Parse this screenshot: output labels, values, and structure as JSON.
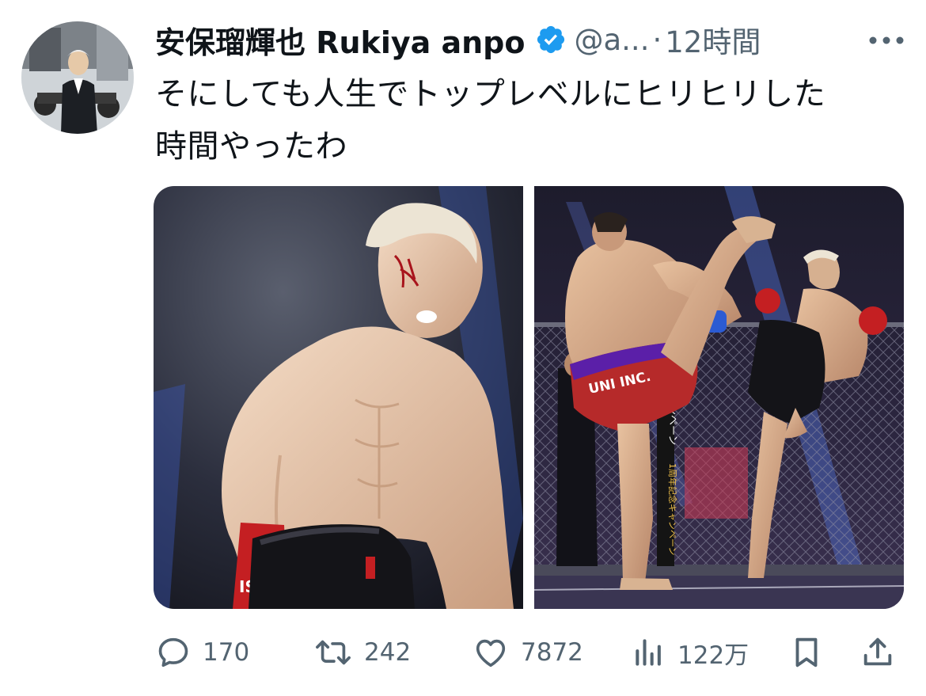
{
  "tweet": {
    "author": {
      "display_name": "安保瑠輝也 Rukiya anpo",
      "handle": "@a...",
      "verified_icon": "verified-badge-icon"
    },
    "separator": "·",
    "timestamp": "12時間",
    "text_line1": "そにしても人生でトップレベルにヒリヒリした",
    "text_line2": "時間やったわ"
  },
  "media": {
    "left_glove_text": "ISAI",
    "right_shorts_text": "UNI INC.",
    "banner_text_1": "キャンペーン",
    "banner_text_2": "1周年記念キャンペーン"
  },
  "actions": {
    "replies": "170",
    "reposts": "242",
    "likes": "7872",
    "views": "122万"
  },
  "colors": {
    "text": "#0f1419",
    "secondary": "#536471",
    "verified": "#1d9bf0"
  }
}
